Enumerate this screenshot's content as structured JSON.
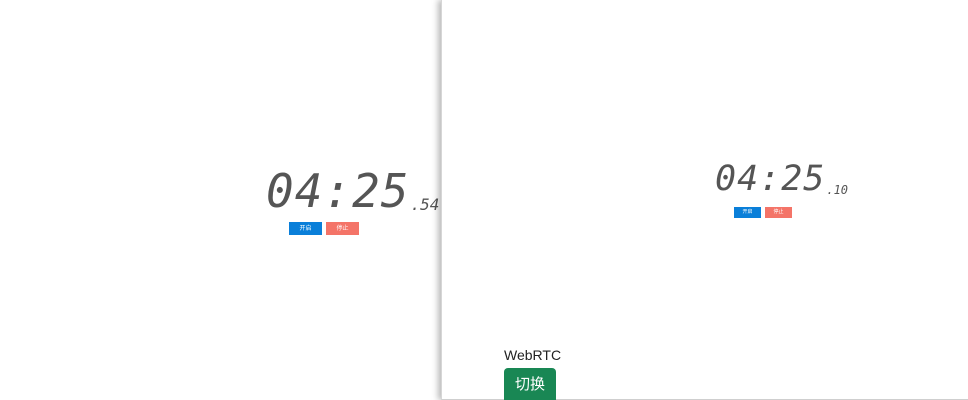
{
  "left_stopwatch": {
    "time_main": "04:25",
    "time_fraction": ".54",
    "start_label": "开启",
    "stop_label": "停止"
  },
  "right_panel": {
    "stopwatch": {
      "time_main": "04:25",
      "time_fraction": ".10",
      "start_label": "开启",
      "stop_label": "停止"
    },
    "webrtc_label": "WebRTC",
    "switch_label": "切换"
  },
  "colors": {
    "start_button": "#0a7fd9",
    "stop_button": "#f47468",
    "switch_button": "#198754",
    "digits": "#555555"
  }
}
